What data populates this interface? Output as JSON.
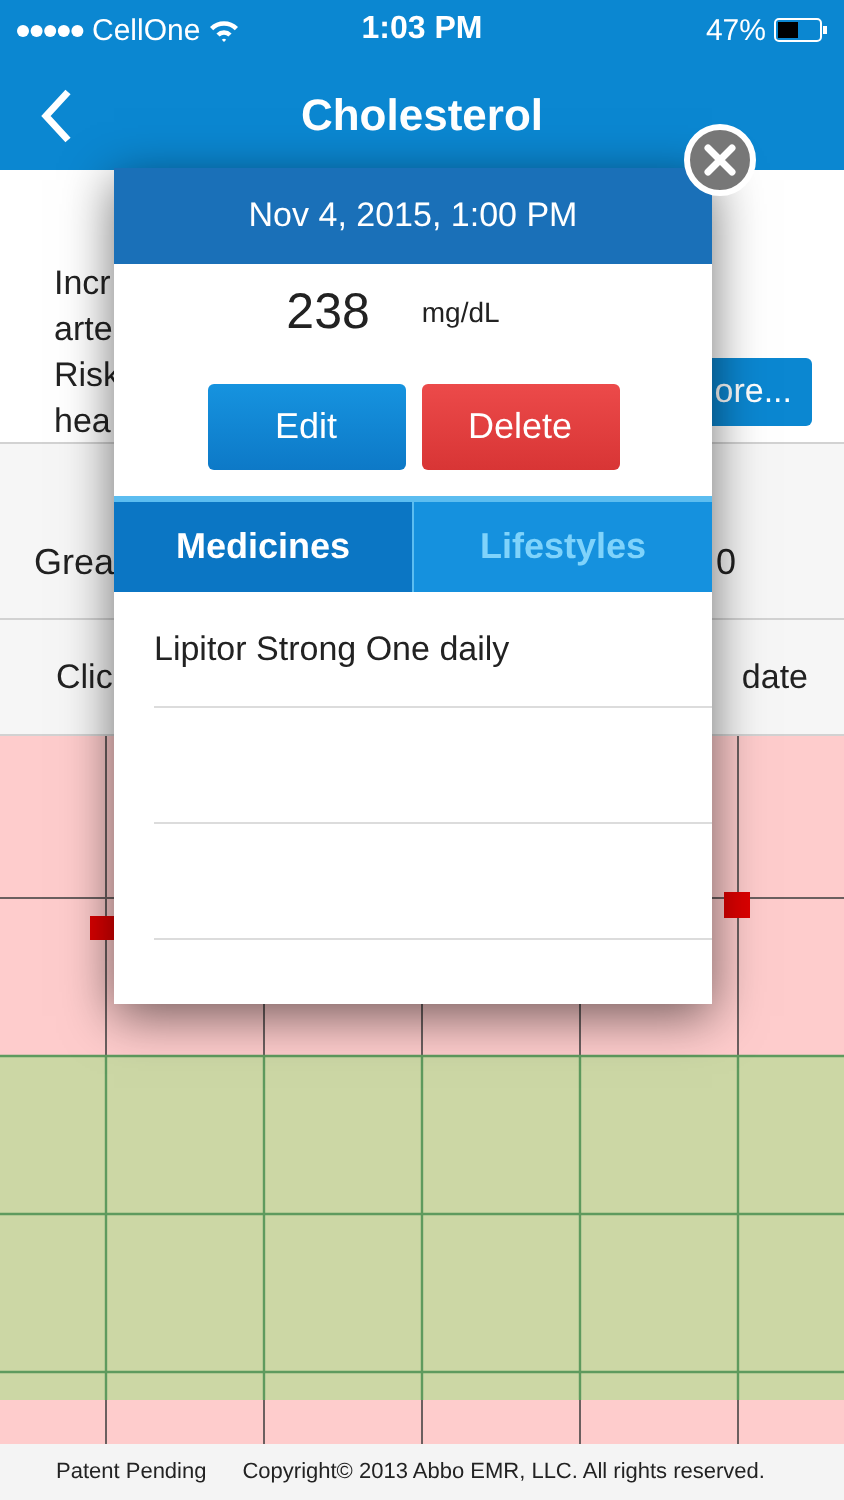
{
  "status_bar": {
    "carrier": "CellOne",
    "time": "1:03 PM",
    "battery": "47%"
  },
  "nav": {
    "title": "Cholesterol"
  },
  "background": {
    "info_lines": [
      "Incr",
      "arte",
      "Risk",
      "hea"
    ],
    "more_button": "ore...",
    "range_row": {
      "label": "Grea",
      "value": "0"
    },
    "hint_row": {
      "left": "Clic",
      "right": "date"
    }
  },
  "dialog": {
    "date": "Nov 4, 2015, 1:00 PM",
    "value": "238",
    "unit": "mg/dL",
    "buttons": [
      {
        "label": "Edit",
        "kind": "edit"
      },
      {
        "label": "Delete",
        "kind": "delete"
      }
    ],
    "tabs": [
      {
        "label": "Medicines",
        "selected": true
      },
      {
        "label": "Lifestyles",
        "selected": false
      }
    ],
    "rows": [
      {
        "text": "Lipitor Strong One daily"
      }
    ]
  },
  "footer": {
    "patent": "Patent Pending",
    "copyright": "Copyright© 2013 Abbo EMR, LLC. All rights reserved."
  }
}
